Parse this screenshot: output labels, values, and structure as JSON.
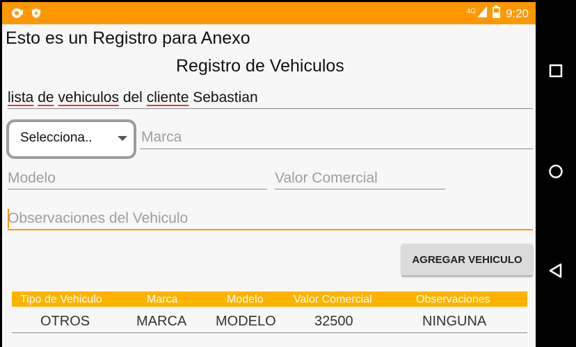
{
  "status_bar": {
    "network": "4G",
    "time": "9:20"
  },
  "titles": {
    "app_title": "Esto es un Registro para Anexo",
    "screen_title": "Registro de Vehiculos"
  },
  "client_line": {
    "w1": "lista",
    "w2": "de",
    "w3": "vehiculos",
    "w4": "del",
    "w5": "cliente",
    "w6": "Sebastian"
  },
  "form": {
    "vehicle_type_selected": "Selecciona..",
    "marca_placeholder": "Marca",
    "modelo_placeholder": "Modelo",
    "valor_placeholder": "Valor Comercial",
    "observaciones_placeholder": "Observaciones del Vehiculo",
    "add_button": "AGREGAR VEHICULO"
  },
  "table": {
    "headers": [
      "Tipo de Vehiculo",
      "Marca",
      "Modelo",
      "Valor Comercial",
      "Observaciones"
    ],
    "rows": [
      [
        "OTROS",
        "MARCA",
        "MODELO",
        "32500",
        "NINGUNA"
      ]
    ]
  },
  "colors": {
    "accent": "#ff9800",
    "table_header": "#ffb300"
  }
}
